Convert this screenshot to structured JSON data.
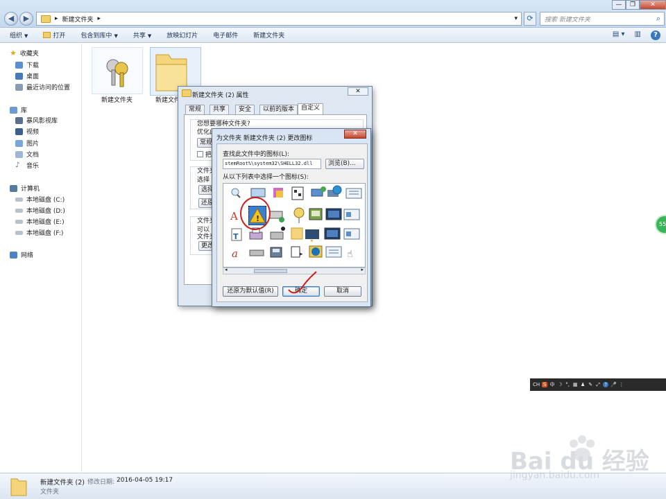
{
  "window": {
    "address_path": "新建文件夹",
    "search_placeholder": "搜索 新建文件夹"
  },
  "toolbar": {
    "items": [
      "组织",
      "打开",
      "包含到库中",
      "共享",
      "放映幻灯片",
      "电子邮件",
      "新建文件夹"
    ]
  },
  "sidebar": {
    "favorites": {
      "header": "收藏夹",
      "items": [
        "下载",
        "桌面",
        "最近访问的位置"
      ]
    },
    "libraries": {
      "header": "库",
      "items": [
        "暴风影视库",
        "视频",
        "图片",
        "文档",
        "音乐"
      ]
    },
    "computer": {
      "header": "计算机",
      "items": [
        "本地磁盘 (C:)",
        "本地磁盘 (D:)",
        "本地磁盘 (E:)",
        "本地磁盘 (F:)"
      ]
    },
    "network": {
      "header": "网络"
    }
  },
  "files": [
    {
      "name": "新建文件夹",
      "icon": "keys-icon"
    },
    {
      "name": "新建文件",
      "icon": "folder-icon"
    }
  ],
  "properties_dialog": {
    "title": "新建文件夹 (2) 属性",
    "tabs": [
      "常规",
      "共享",
      "安全",
      "以前的版本",
      "自定义"
    ],
    "active_tab": "自定义",
    "question": "您想要哪种文件夹?",
    "optimize_label": "优化此文件夹",
    "dropdown_value": "常规",
    "checkbox_label": "把",
    "section2_a": "文件夹",
    "section2_b": "选择",
    "select_button": "选择",
    "restore_button": "还原",
    "section3_a": "文件夹",
    "section3_b": "可以",
    "section3_c": "文件夹",
    "change_button": "更改"
  },
  "change_icon_dialog": {
    "title": "为文件夹 新建文件夹 (2) 更改图标",
    "find_label": "查找此文件中的图标(L):",
    "path_value": "stemRoot%\\system32\\SHELL32.dll",
    "browse_button": "浏览(B)...",
    "list_label": "从以下列表中选择一个图标(S):",
    "restore_default_button": "还原为默认值(R)",
    "ok_button": "确定",
    "cancel_button": "取消",
    "selected_icon": "warning-icon"
  },
  "status_bar": {
    "name": "新建文件夹 (2)",
    "modified_label": "修改日期:",
    "modified_value": "2016-04-05 19:17",
    "type": "文件夹"
  },
  "ime_bar": {
    "items": [
      "CH",
      "S",
      "中",
      "☽",
      "°,",
      "▦",
      "♟",
      "✎",
      "⤢",
      "?",
      "🎤",
      "⋮"
    ]
  },
  "side_bubble": "55",
  "watermark": {
    "brand": "Bai du 经验",
    "url": "jingyan.baidu.com"
  },
  "colors": {
    "accent": "#3a77c0",
    "close_red": "#c2462e",
    "folder_yellow": "#f2cf6d"
  }
}
